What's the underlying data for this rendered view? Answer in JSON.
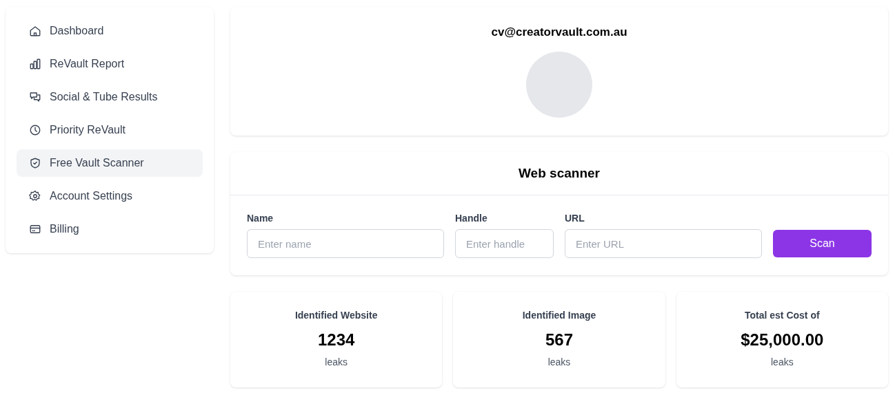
{
  "sidebar": {
    "items": [
      {
        "label": "Dashboard",
        "selected": false
      },
      {
        "label": "ReVault Report",
        "selected": false
      },
      {
        "label": "Social & Tube Results",
        "selected": false
      },
      {
        "label": "Priority ReVault",
        "selected": false
      },
      {
        "label": "Free Vault Scanner",
        "selected": true
      },
      {
        "label": "Account Settings",
        "selected": false
      },
      {
        "label": "Billing",
        "selected": false
      }
    ]
  },
  "profile": {
    "email": "cv@creatorvault.com.au"
  },
  "scanner": {
    "title": "Web scanner",
    "fields": [
      {
        "label": "Name",
        "placeholder": "Enter name"
      },
      {
        "label": "Handle",
        "placeholder": "Enter handle"
      },
      {
        "label": "URL",
        "placeholder": "Enter URL"
      }
    ],
    "button": "Scan"
  },
  "stats": [
    {
      "title": "Identified Website",
      "value": "1234",
      "unit": "leaks"
    },
    {
      "title": "Identified Image",
      "value": "567",
      "unit": "leaks"
    },
    {
      "title": "Total est Cost of",
      "value": "$25,000.00",
      "unit": "leaks"
    }
  ]
}
